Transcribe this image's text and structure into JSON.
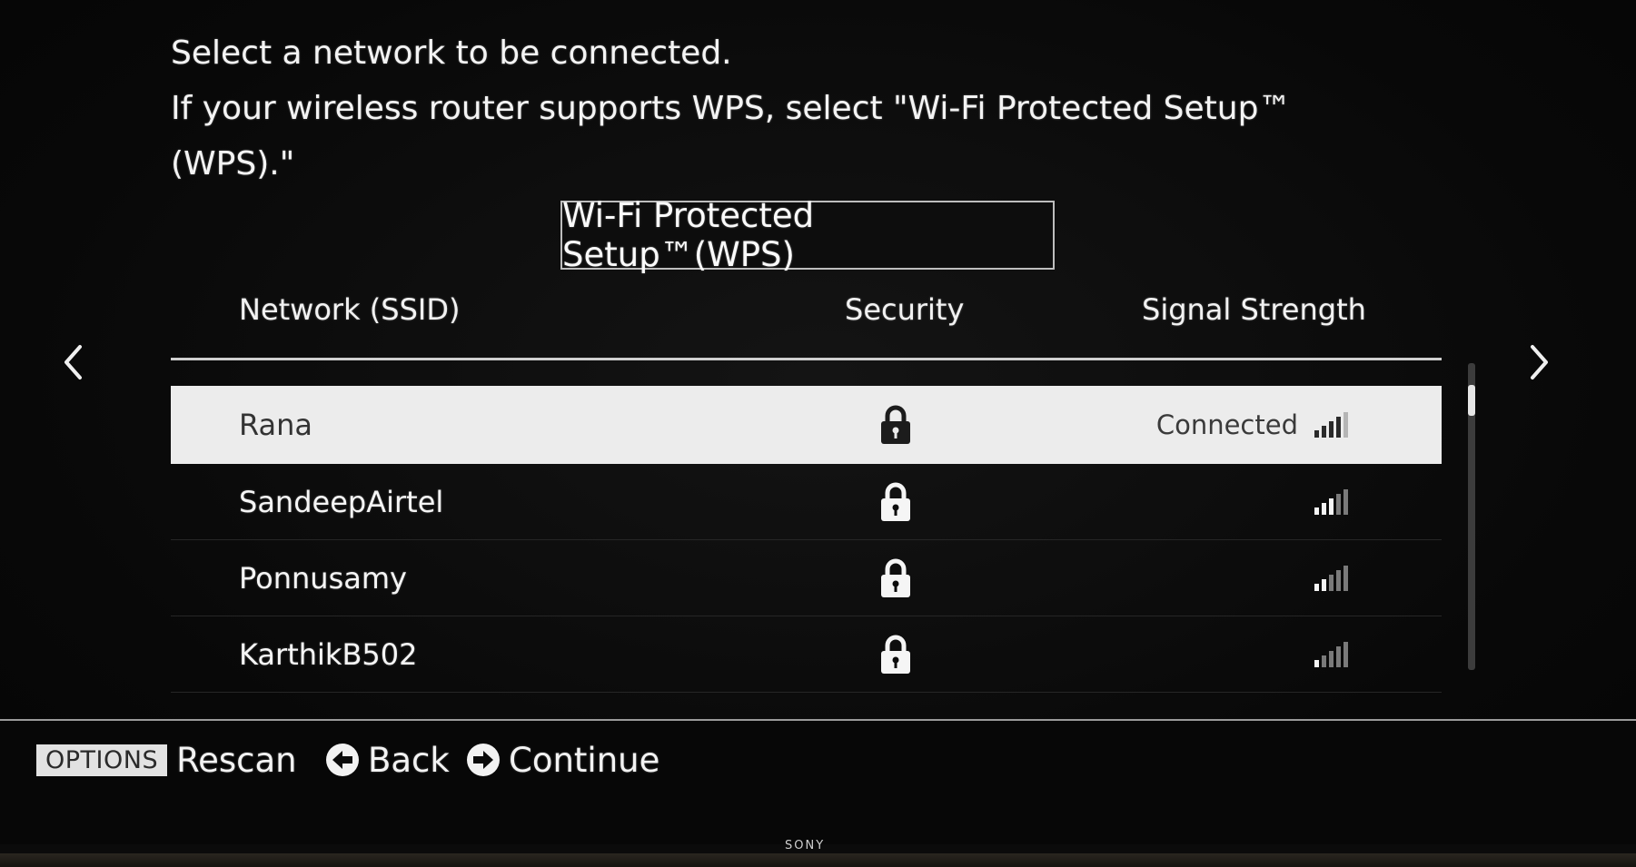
{
  "instructions": {
    "line1": "Select a network to be connected.",
    "line2": "If your wireless router supports WPS, select \"Wi-Fi Protected Setup™",
    "line3": "(WPS).\""
  },
  "wps_button": {
    "label": "Wi-Fi Protected Setup™(WPS)"
  },
  "columns": {
    "ssid": "Network (SSID)",
    "security": "Security",
    "signal": "Signal Strength"
  },
  "networks": [
    {
      "ssid": "Rana",
      "secured": true,
      "status": "Connected",
      "signal_bars": 4,
      "selected": true
    },
    {
      "ssid": "SandeepAirtel",
      "secured": true,
      "status": "",
      "signal_bars": 3,
      "selected": false
    },
    {
      "ssid": "Ponnusamy",
      "secured": true,
      "status": "",
      "signal_bars": 2,
      "selected": false
    },
    {
      "ssid": "KarthikB502",
      "secured": true,
      "status": "",
      "signal_bars": 1,
      "selected": false
    }
  ],
  "footer": {
    "options_badge": "OPTIONS",
    "rescan": "Rescan",
    "back": "Back",
    "continue": "Continue"
  },
  "brand": "SONY",
  "colors": {
    "background": "#0b0b0b",
    "selected_row": "#ececec",
    "text": "#f2f2f2"
  }
}
